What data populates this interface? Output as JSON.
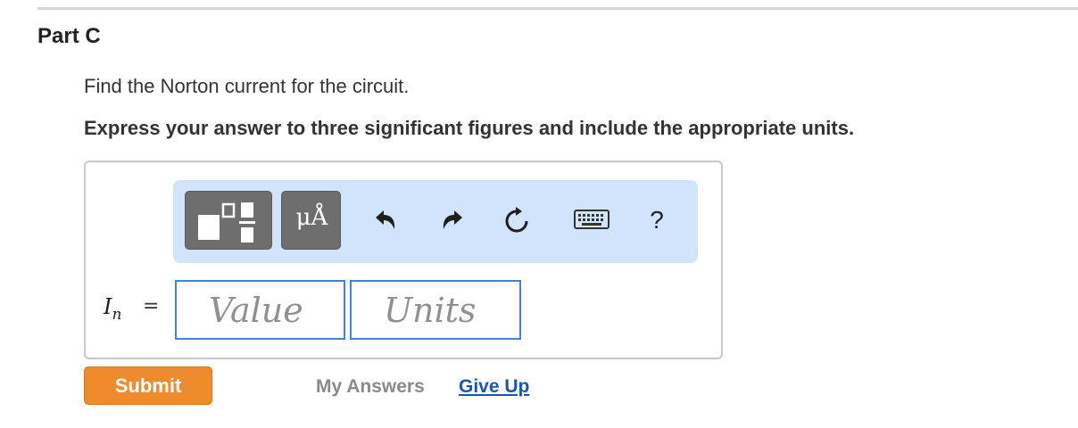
{
  "part": {
    "title": "Part C"
  },
  "question": {
    "prompt": "Find the Norton current for the circuit.",
    "instruction": "Express your answer to three significant figures and include the appropriate units."
  },
  "toolbar": {
    "templates_icon": "templates-icon",
    "units_label": "μÅ",
    "undo_icon": "undo-icon",
    "redo_icon": "redo-icon",
    "reset_icon": "reset-icon",
    "keyboard_icon": "keyboard-icon",
    "help_label": "?"
  },
  "answer": {
    "variable": "I",
    "subscript": "n",
    "equals": "=",
    "value_placeholder": "Value",
    "units_placeholder": "Units",
    "value": "",
    "units": ""
  },
  "actions": {
    "submit_label": "Submit",
    "my_answers_label": "My Answers",
    "give_up_label": "Give Up"
  },
  "colors": {
    "toolbar_bg": "#d2e4fb",
    "button_dark": "#6e6e6e",
    "submit_orange": "#ee8b2c",
    "link_blue": "#1a55b4",
    "field_border": "#4a7fd6"
  }
}
